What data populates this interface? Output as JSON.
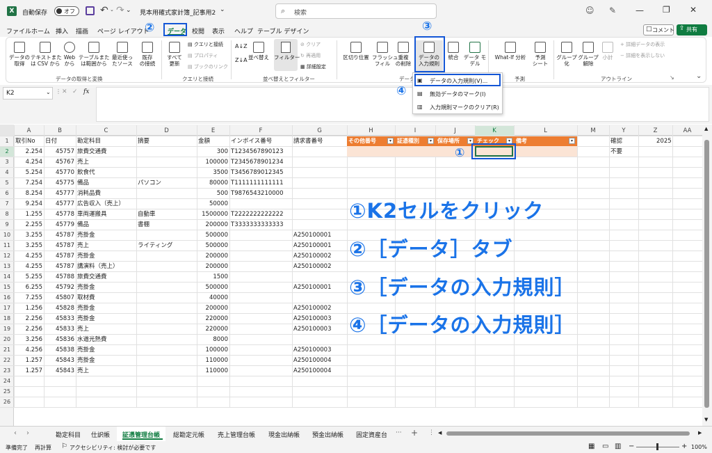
{
  "titlebar": {
    "autosave_label": "自動保存",
    "autosave_state": "オフ",
    "filename": "見本用確式家計簿_記事用2",
    "search_placeholder": "検索",
    "qat_more": "⌄"
  },
  "menu": {
    "items": [
      "ファイル",
      "ホーム",
      "挿入",
      "描画",
      "ページ レイアウト",
      "データ",
      "校閲",
      "表示",
      "ヘルプ",
      "テーブル デザイン"
    ],
    "active": "データ",
    "comment": "コメント",
    "share": "共有"
  },
  "ribbon": {
    "get_data": [
      {
        "label": "データの\n取得",
        "arrow": "⌄"
      },
      {
        "label": "テキストまた\nは CSV から"
      },
      {
        "label": "Web\nから"
      },
      {
        "label": "テーブルまた\nは範囲から"
      },
      {
        "label": "最近使っ\nたソース"
      },
      {
        "label": "既存\nの接続"
      }
    ],
    "get_group": "データの取得と変換",
    "queries_all": "すべて\n更新",
    "queries": [
      {
        "label": "クエリと接続",
        "disabled": false
      },
      {
        "label": "プロパティ",
        "disabled": true
      },
      {
        "label": "ブックのリンク",
        "disabled": true
      }
    ],
    "queries_group": "クエリと接続",
    "sort_az": "A↓Z",
    "sort_za": "Z↓A",
    "sort": "並べ替え",
    "filter": "フィルター",
    "filter_small": [
      {
        "label": "クリア",
        "disabled": true
      },
      {
        "label": "再適用",
        "disabled": true
      },
      {
        "label": "詳細設定",
        "disabled": false
      }
    ],
    "sort_group": "並べ替えとフィルター",
    "tools": [
      {
        "label": "区切り位置"
      },
      {
        "label": "フラッシュ\nフィル"
      },
      {
        "label": "重複\nの削除"
      },
      {
        "label": "データの\n入力規則"
      },
      {
        "label": "統合"
      },
      {
        "label": "データ モ\nデル"
      }
    ],
    "tools_group": "データ",
    "forecast": [
      {
        "label": "What-If 分析"
      },
      {
        "label": "予測\nシート"
      }
    ],
    "forecast_group": "予測",
    "outline": [
      {
        "label": "グループ\n化"
      },
      {
        "label": "グループ\n解除"
      },
      {
        "label": "小計"
      }
    ],
    "outline_small": [
      {
        "label": "詳細データの表示"
      },
      {
        "label": "詳細を表示しない"
      }
    ],
    "outline_group": "アウトライン"
  },
  "dropdown": {
    "items": [
      "データの入力規則(V)...",
      "無効データのマーク(I)",
      "入力規則マークのクリア(R)"
    ]
  },
  "formula": {
    "namebox": "K2",
    "fx": "fx",
    "cancel": "✕",
    "enter": "✓"
  },
  "columns": [
    "A",
    "B",
    "C",
    "D",
    "E",
    "F",
    "G",
    "H",
    "I",
    "J",
    "K",
    "L",
    "M",
    "Y",
    "Z",
    "AA"
  ],
  "header_row": [
    "取引No",
    "日付",
    "勘定科目",
    "摘要",
    "金額",
    "インボイス番号",
    "請求書番号"
  ],
  "orange_headers": [
    "その他番号",
    "証憑種別",
    "保存場所",
    "チェック",
    "備考"
  ],
  "side": {
    "y1": "確認",
    "z1": "2025",
    "y2": "不要"
  },
  "rows": [
    [
      "2.254",
      "45757",
      "旅費交通費",
      "",
      "300",
      "T1234567890123",
      ""
    ],
    [
      "4.254",
      "45767",
      "売上",
      "",
      "100000",
      "T2345678901234",
      ""
    ],
    [
      "5.254",
      "45770",
      "飲食代",
      "",
      "3500",
      "T3456789012345",
      ""
    ],
    [
      "7.254",
      "45775",
      "備品",
      "パソコン",
      "80000",
      "T1111111111111",
      ""
    ],
    [
      "8.254",
      "45777",
      "消耗品費",
      "",
      "500",
      "T9876543210000",
      ""
    ],
    [
      "9.254",
      "45777",
      "広告収入（売上）",
      "",
      "50000",
      "",
      ""
    ],
    [
      "1.255",
      "45778",
      "車両運搬具",
      "自動車",
      "1500000",
      "T2222222222222",
      ""
    ],
    [
      "2.255",
      "45779",
      "備品",
      "書棚",
      "200000",
      "T3333333333333",
      ""
    ],
    [
      "3.255",
      "45787",
      "売掛金",
      "",
      "500000",
      "",
      "A250100001"
    ],
    [
      "3.255",
      "45787",
      "売上",
      "ライティング",
      "500000",
      "",
      "A250100001"
    ],
    [
      "4.255",
      "45787",
      "売掛金",
      "",
      "200000",
      "",
      "A250100002"
    ],
    [
      "4.255",
      "45787",
      "講演料（売上）",
      "",
      "200000",
      "",
      "A250100002"
    ],
    [
      "5.255",
      "45788",
      "旅費交通費",
      "",
      "1500",
      "",
      ""
    ],
    [
      "6.255",
      "45792",
      "売掛金",
      "",
      "500000",
      "",
      "A250100001"
    ],
    [
      "7.255",
      "45807",
      "取材費",
      "",
      "40000",
      "",
      ""
    ],
    [
      "1.256",
      "45828",
      "売掛金",
      "",
      "200000",
      "",
      "A250100002"
    ],
    [
      "2.256",
      "45833",
      "売掛金",
      "",
      "220000",
      "",
      "A250100003"
    ],
    [
      "2.256",
      "45833",
      "売上",
      "",
      "220000",
      "",
      "A250100003"
    ],
    [
      "3.256",
      "45836",
      "水道光熱費",
      "",
      "8000",
      "",
      ""
    ],
    [
      "4.256",
      "45838",
      "売掛金",
      "",
      "100000",
      "",
      "A250100003"
    ],
    [
      "1.257",
      "45843",
      "売掛金",
      "",
      "110000",
      "",
      "A250100004"
    ],
    [
      "1.257",
      "45843",
      "売上",
      "",
      "110000",
      "",
      "A250100004"
    ]
  ],
  "row_numbers": [
    "1",
    "2",
    "3",
    "4",
    "5",
    "6",
    "7",
    "8",
    "9",
    "10",
    "11",
    "12",
    "13",
    "14",
    "15",
    "16",
    "17",
    "18",
    "19",
    "20",
    "21",
    "22",
    "23",
    "24",
    "25",
    "26"
  ],
  "sheets": [
    "勘定科目",
    "仕訳帳",
    "証憑管理台帳",
    "総勘定元帳",
    "売上管理台帳",
    "現金出納帳",
    "預金出納帳",
    "固定資産台"
  ],
  "active_sheet": "証憑管理台帳",
  "status": {
    "ready": "準備完了",
    "recalc": "再計算",
    "accessibility": "アクセシビリティ: 検討が必要です",
    "zoom": "100%"
  },
  "instructions": [
    "①K2セルをクリック",
    "②［データ］タブ",
    "③［データの入力規則］",
    "④［データの入力規則］"
  ],
  "badges": {
    "b1": "①",
    "b2": "②",
    "b3": "③",
    "b4": "④"
  },
  "colors": {
    "accent": "#1a73e8",
    "header_orange": "#ed7d31",
    "excel_green": "#217346",
    "share_green": "#107c41"
  }
}
